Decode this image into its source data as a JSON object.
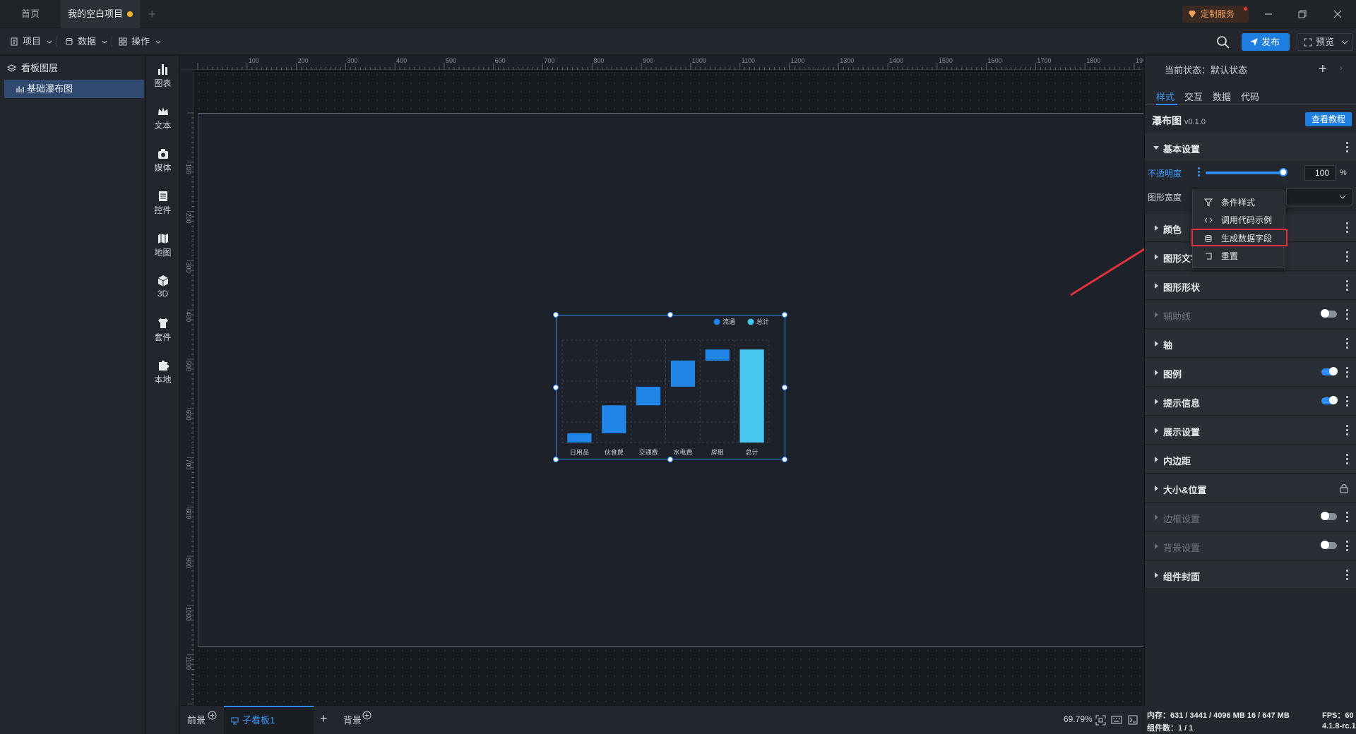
{
  "titlebar": {
    "tab_home": "首页",
    "tab_project": "我的空白项目",
    "custom_service": "定制服务"
  },
  "toolbar": {
    "menu_project": "项目",
    "menu_data": "数据",
    "menu_operate": "操作",
    "publish": "发布",
    "preview": "预览"
  },
  "layers": {
    "header": "看板图层",
    "items": [
      "基础瀑布图"
    ]
  },
  "components": [
    "图表",
    "文本",
    "媒体",
    "控件",
    "地图",
    "3D",
    "套件",
    "本地"
  ],
  "ruler": {
    "top_ticks": [
      "100",
      "200",
      "300",
      "400",
      "500",
      "600",
      "700",
      "800",
      "900",
      "1000",
      "1100",
      "1200",
      "1300",
      "1400",
      "1500",
      "1600",
      "1700",
      "1800",
      "1900"
    ],
    "left_ticks": [
      "100",
      "200",
      "300",
      "400",
      "500",
      "600",
      "700",
      "800",
      "900",
      "1000",
      "1100"
    ]
  },
  "chart_data": {
    "type": "bar",
    "subtype": "waterfall",
    "categories": [
      "日用品",
      "伙食费",
      "交通费",
      "水电费",
      "房租",
      "总计"
    ],
    "series": [
      {
        "name": "流通",
        "base": [
          0,
          10,
          40,
          60,
          88,
          0
        ],
        "values": [
          10,
          30,
          20,
          28,
          12,
          0
        ],
        "color": "#1f85e6"
      },
      {
        "name": "总计",
        "base": [
          0,
          0,
          0,
          0,
          0,
          0
        ],
        "values": [
          0,
          0,
          0,
          0,
          0,
          100
        ],
        "color": "#47c7f0"
      }
    ],
    "ylim": [
      0,
      110
    ],
    "grid": true,
    "legend": "top-right"
  },
  "bottombar": {
    "foreground": "前景",
    "subboard": "子看板1",
    "background": "背景",
    "zoom": "69.79%"
  },
  "props": {
    "state": "当前状态：默认状态",
    "tabs": [
      "样式",
      "交互",
      "数据",
      "代码"
    ],
    "component_name": "瀑布图",
    "version": "v0.1.0",
    "tutorial": "查看教程",
    "basic_settings": "基本设置",
    "opacity_label": "不透明度",
    "opacity_value": "100",
    "opacity_unit": "%",
    "width_label": "图形宽度",
    "sections": [
      "颜色",
      "图形文字",
      "图形形状",
      "辅助线",
      "轴",
      "图例",
      "提示信息",
      "展示设置",
      "内边距",
      "大小&位置",
      "边框设置",
      "背景设置",
      "组件封面"
    ]
  },
  "context_menu": {
    "items": [
      "条件样式",
      "调用代码示例",
      "生成数据字段",
      "重置"
    ],
    "highlighted_index": 2
  },
  "status": {
    "memory": "内存：631 / 3441 / 4096 MB  16 / 647 MB",
    "fps": "FPS：60",
    "count": "组件数：1 / 1",
    "version": "4.1.8-rc.1"
  },
  "colors": {
    "accent": "#2f8cff",
    "highlight_border": "#e0323a",
    "bar_main": "#1f85e6",
    "bar_total": "#47c7f0"
  }
}
